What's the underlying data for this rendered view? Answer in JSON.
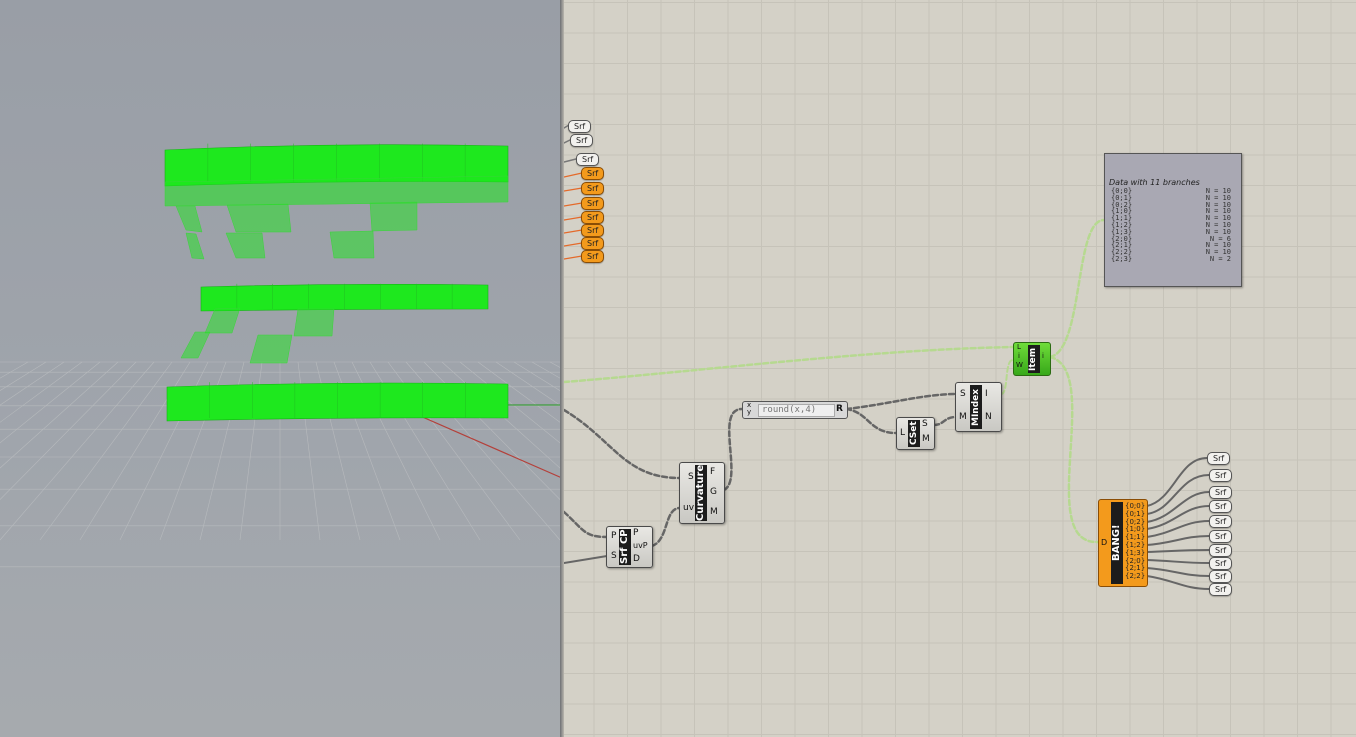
{
  "viewport": {
    "name": "Rhino perspective viewport",
    "geometry_color": "#1ee81e"
  },
  "canvas": {
    "left_params": [
      {
        "label": "Srf",
        "color": "white"
      },
      {
        "label": "Srf",
        "color": "white"
      },
      {
        "label": "Srf",
        "color": "white"
      },
      {
        "label": "Srf",
        "color": "orange"
      },
      {
        "label": "Srf",
        "color": "orange"
      },
      {
        "label": "Srf",
        "color": "orange"
      },
      {
        "label": "Srf",
        "color": "orange"
      },
      {
        "label": "Srf",
        "color": "orange"
      },
      {
        "label": "Srf",
        "color": "orange"
      },
      {
        "label": "Srf",
        "color": "orange"
      }
    ],
    "srf_cp": {
      "name": "Srf CP",
      "inputs": [
        "P",
        "S"
      ],
      "outputs": [
        "P",
        "uvP",
        "D"
      ]
    },
    "curvature": {
      "name": "Curvature",
      "inputs": [
        "S",
        "uv"
      ],
      "outputs": [
        "F",
        "G",
        "M"
      ]
    },
    "expression": {
      "inputs": [
        "x",
        "y"
      ],
      "text": "round(x,4)",
      "output": "R"
    },
    "cset": {
      "name": "CSet",
      "inputs": [
        "L"
      ],
      "outputs": [
        "S",
        "M"
      ]
    },
    "mindex": {
      "name": "MIndex",
      "inputs": [
        "S",
        "M"
      ],
      "outputs": [
        "I",
        "N"
      ]
    },
    "item": {
      "name": "Item",
      "inputs": [
        "L",
        "i",
        "W"
      ],
      "outputs": [
        "i"
      ]
    },
    "panel": {
      "title": "Data with 11 branches",
      "rows": [
        {
          "path": "{0;0}",
          "n": "N = 10"
        },
        {
          "path": "{0;1}",
          "n": "N = 10"
        },
        {
          "path": "{0;2}",
          "n": "N = 10"
        },
        {
          "path": "{1;0}",
          "n": "N = 10"
        },
        {
          "path": "{1;1}",
          "n": "N = 10"
        },
        {
          "path": "{1;2}",
          "n": "N = 10"
        },
        {
          "path": "{1;3}",
          "n": "N = 10"
        },
        {
          "path": "{2;0}",
          "n": "N = 6"
        },
        {
          "path": "{2;1}",
          "n": "N = 10"
        },
        {
          "path": "{2;2}",
          "n": "N = 10"
        },
        {
          "path": "{2;3}",
          "n": "N = 2"
        }
      ]
    },
    "bang": {
      "name": "BANG!",
      "input": "D",
      "outputs": [
        "{0;0}",
        "{0;1}",
        "{0;2}",
        "{1;0}",
        "{1;1}",
        "{1;2}",
        "{1;3}",
        "{2;0}",
        "{2;1}",
        "{2;2}"
      ]
    },
    "right_params": [
      "Srf",
      "Srf",
      "Srf",
      "Srf",
      "Srf",
      "Srf",
      "Srf",
      "Srf",
      "Srf",
      "Srf"
    ]
  }
}
